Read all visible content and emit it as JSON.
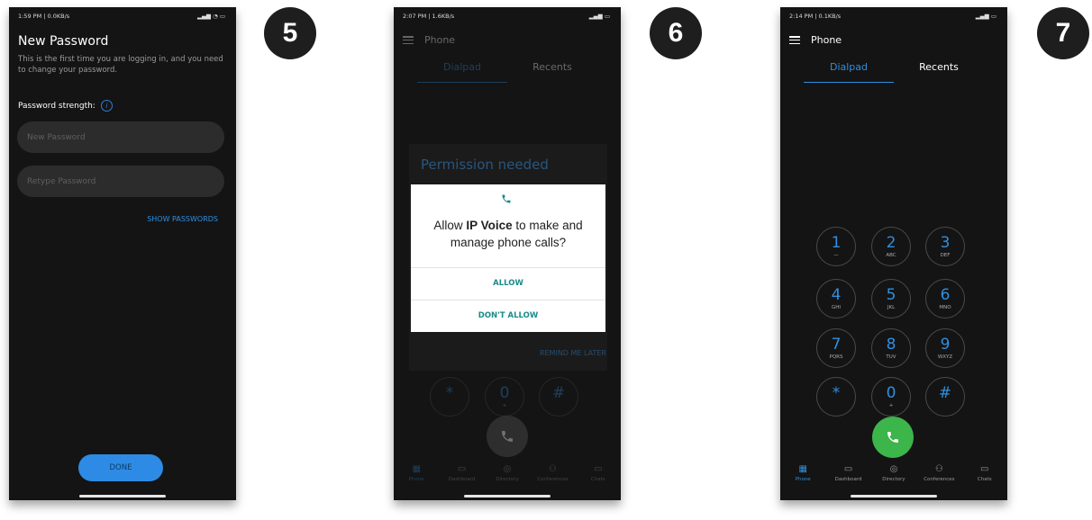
{
  "steps": [
    "5",
    "6",
    "7"
  ],
  "screen5": {
    "status_time": "1:59 PM | 0.0KB/s",
    "title": "New Password",
    "subtitle": "This is the first time you are logging in, and you need to change your password.",
    "strength_label": "Password strength:",
    "new_password_placeholder": "New Password",
    "retype_password_placeholder": "Retype Password",
    "show_passwords": "SHOW PASSWORDS",
    "done": "DONE"
  },
  "screen6": {
    "status_time": "2:07 PM | 1.6KB/s",
    "app_title": "Phone",
    "tabs": [
      "Dialpad",
      "Recents"
    ],
    "permission_title": "Permission needed",
    "remind_later": "REMIND ME LATER",
    "dialog": {
      "prefix": "Allow ",
      "app_name": "IP Voice",
      "suffix": " to make and manage phone calls?",
      "allow": "ALLOW",
      "deny": "DON'T ALLOW"
    },
    "keys": [
      {
        "d": "*",
        "l": ""
      },
      {
        "d": "0",
        "l": "+"
      },
      {
        "d": "#",
        "l": ""
      }
    ],
    "nav": [
      "Phone",
      "Dashboard",
      "Directory",
      "Conferences",
      "Chats"
    ]
  },
  "screen7": {
    "status_time": "2:14 PM | 0.1KB/s",
    "app_title": "Phone",
    "tabs": [
      "Dialpad",
      "Recents"
    ],
    "keys": [
      {
        "d": "1",
        "l": "—"
      },
      {
        "d": "2",
        "l": "ABC"
      },
      {
        "d": "3",
        "l": "DEF"
      },
      {
        "d": "4",
        "l": "GHI"
      },
      {
        "d": "5",
        "l": "JKL"
      },
      {
        "d": "6",
        "l": "MNO"
      },
      {
        "d": "7",
        "l": "PQRS"
      },
      {
        "d": "8",
        "l": "TUV"
      },
      {
        "d": "9",
        "l": "WXYZ"
      },
      {
        "d": "*",
        "l": ""
      },
      {
        "d": "0",
        "l": "+"
      },
      {
        "d": "#",
        "l": ""
      }
    ],
    "nav": [
      "Phone",
      "Dashboard",
      "Directory",
      "Conferences",
      "Chats"
    ]
  },
  "colors": {
    "accent": "#2f8fe0",
    "call_green": "#3cb54a",
    "call_grey": "#3a3a3a",
    "screen_bg": "#141414"
  }
}
